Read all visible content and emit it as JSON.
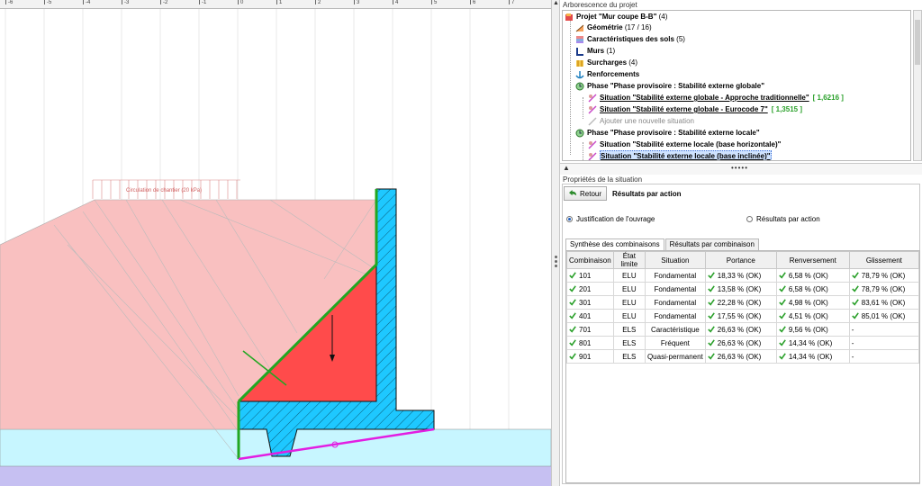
{
  "ruler": {
    "labels": [
      "-6",
      "-5",
      "-4",
      "-3",
      "-2",
      "-1",
      "0",
      "1",
      "2",
      "3",
      "4",
      "5",
      "6",
      "7"
    ]
  },
  "drawing": {
    "surcharge_label": "Circulation de chantier (20 kPa)",
    "colors": {
      "backfill": "#f9c0c0",
      "wedge": "#ff4b4b",
      "wall": "#1ec8ff",
      "foundation_soil": "#c7f6ff",
      "bedrock": "#c6c0f2",
      "thrust_line": "#22a722",
      "base_line": "#e21ee2"
    }
  },
  "tree": {
    "title": "Arborescence du projet",
    "project": {
      "label": "Projet \"Mur coupe B-B\"",
      "count": "(4)"
    },
    "items": [
      {
        "label": "Géométrie",
        "extra": "(17 / 16)",
        "icon": "geometry-icon"
      },
      {
        "label": "Caractéristiques des sols",
        "extra": "(5)",
        "icon": "soil-icon"
      },
      {
        "label": "Murs",
        "extra": "(1)",
        "icon": "wall-icon"
      },
      {
        "label": "Surcharges",
        "extra": "(4)",
        "icon": "surcharge-icon"
      },
      {
        "label": "Renforcements",
        "extra": "",
        "icon": "anchor-icon"
      }
    ],
    "phase1": {
      "label": "Phase \"Phase provisoire : Stabilité externe globale\""
    },
    "phase1_items": [
      {
        "label": "Situation \"Stabilité externe globale - Approche traditionnelle\"",
        "value": "[ 1,6216 ]"
      },
      {
        "label": "Situation \"Stabilité externe globale - Eurocode 7\"",
        "value": "[ 1,3515 ]"
      }
    ],
    "add_situation": "Ajouter une nouvelle situation",
    "phase2": {
      "label": "Phase \"Phase provisoire : Stabilité externe locale\""
    },
    "phase2_items": [
      {
        "label": "Situation \"Stabilité externe locale (base horizontale)\""
      },
      {
        "label": "Situation \"Stabilité externe locale (base inclinée)\""
      }
    ]
  },
  "splitter": {
    "left": "▲",
    "right": "▼"
  },
  "props": {
    "title": "Propriétés de la situation",
    "back_label": "Retour",
    "results_title": "Résultats par action",
    "radio1": "Justification de l'ouvrage",
    "radio2": "Résultats par action",
    "tab1": "Synthèse des combinaisons",
    "tab2": "Résultats par combinaison",
    "columns": [
      "Combinaison",
      "État limite",
      "Situation",
      "Portance",
      "Renversement",
      "Glissement"
    ],
    "rows": [
      {
        "comb": "101",
        "etat": "ELU",
        "situation": "Fondamental",
        "portance": "18,33 % (OK)",
        "renversement": "6,58 % (OK)",
        "glissement": "78,79 % (OK)"
      },
      {
        "comb": "201",
        "etat": "ELU",
        "situation": "Fondamental",
        "portance": "13,58 % (OK)",
        "renversement": "6,58 % (OK)",
        "glissement": "78,79 % (OK)"
      },
      {
        "comb": "301",
        "etat": "ELU",
        "situation": "Fondamental",
        "portance": "22,28 % (OK)",
        "renversement": "4,98 % (OK)",
        "glissement": "83,61 % (OK)"
      },
      {
        "comb": "401",
        "etat": "ELU",
        "situation": "Fondamental",
        "portance": "17,55 % (OK)",
        "renversement": "4,51 % (OK)",
        "glissement": "85,01 % (OK)"
      },
      {
        "comb": "701",
        "etat": "ELS",
        "situation": "Caractéristique",
        "portance": "26,63 % (OK)",
        "renversement": "9,56 % (OK)",
        "glissement": "-"
      },
      {
        "comb": "801",
        "etat": "ELS",
        "situation": "Fréquent",
        "portance": "26,63 % (OK)",
        "renversement": "14,34 % (OK)",
        "glissement": "-"
      },
      {
        "comb": "901",
        "etat": "ELS",
        "situation": "Quasi-permanent",
        "portance": "26,63 % (OK)",
        "renversement": "14,34 % (OK)",
        "glissement": "-"
      }
    ]
  }
}
